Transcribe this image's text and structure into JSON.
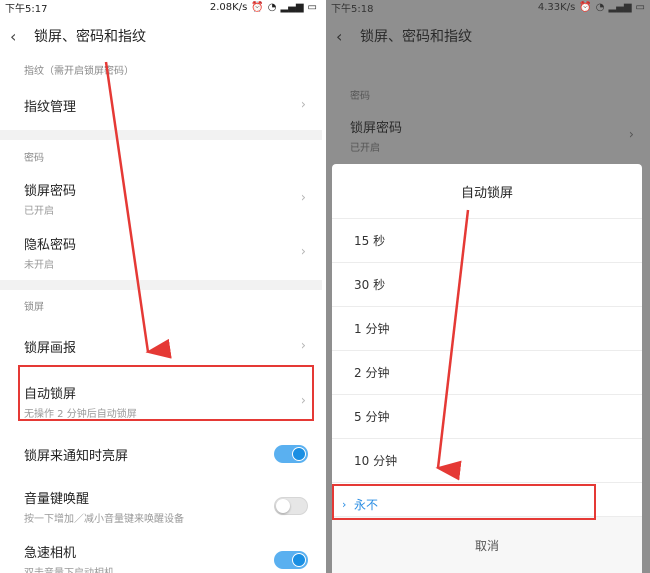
{
  "left": {
    "status": {
      "time": "下午5:17",
      "speed": "2.08K/s"
    },
    "title": "锁屏、密码和指纹",
    "sections": {
      "fingerprint": "指纹（需开启锁屏密码）",
      "password": "密码",
      "lock": "锁屏"
    },
    "items": {
      "fingerprint_mgmt": "指纹管理",
      "lock_password": {
        "title": "锁屏密码",
        "sub": "已开启"
      },
      "privacy_password": {
        "title": "隐私密码",
        "sub": "未开启"
      },
      "lock_wallpaper": "锁屏画报",
      "auto_lock": {
        "title": "自动锁屏",
        "sub": "无操作 2 分钟后自动锁屏"
      },
      "notify_light": {
        "title": "锁屏来通知时亮屏",
        "on": true
      },
      "volume_wake": {
        "title": "音量键唤醒",
        "sub": "按一下增加／减小音量键来唤醒设备",
        "on": false
      },
      "quick_camera": {
        "title": "急速相机",
        "sub": "双击音量下启动相机",
        "on": true
      }
    }
  },
  "right": {
    "status": {
      "time": "下午5:18",
      "speed": "4.33K/s"
    },
    "title": "锁屏、密码和指纹",
    "section": "密码",
    "lock_password": {
      "title": "锁屏密码",
      "sub": "已开启"
    },
    "dialog": {
      "title": "自动锁屏",
      "options": [
        "15 秒",
        "30 秒",
        "1 分钟",
        "2 分钟",
        "5 分钟",
        "10 分钟",
        "永不"
      ],
      "selected": "永不",
      "cancel": "取消"
    }
  },
  "colors": {
    "accent": "#2a8de3",
    "highlight": "#e53935",
    "arrow": "#e53935"
  }
}
